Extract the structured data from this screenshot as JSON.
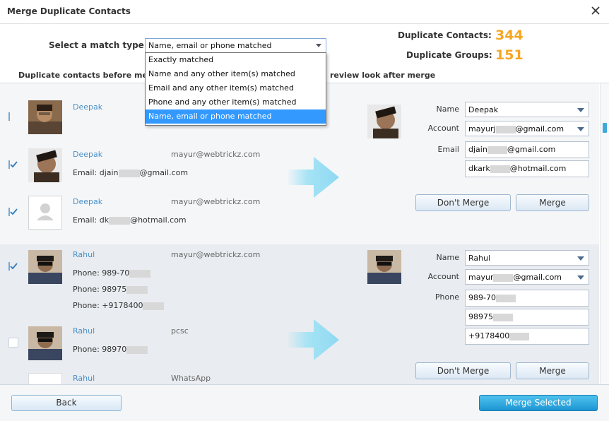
{
  "window": {
    "title": "Merge Duplicate Contacts"
  },
  "match": {
    "label": "Select a match type:",
    "selected": "Name, email or phone matched",
    "options": [
      "Exactly matched",
      "Name and any other item(s) matched",
      "Email and any other item(s) matched",
      "Phone and any other item(s) matched",
      "Name, email or phone matched"
    ]
  },
  "stats": {
    "contacts_label": "Duplicate Contacts:",
    "contacts_value": "344",
    "groups_label": "Duplicate Groups:",
    "groups_value": "151"
  },
  "columns": {
    "left": "Duplicate contacts before merg",
    "right": "review look after merge"
  },
  "groups": [
    {
      "contacts": [
        {
          "name": "Deepak",
          "source": "",
          "lines": []
        },
        {
          "name": "Deepak",
          "source": "mayur@webtrickz.com",
          "lines": [
            {
              "prefix": "Email: djain",
              "suffix": "@gmail.com"
            }
          ]
        },
        {
          "name": "Deepak",
          "source": "mayur@webtrickz.com",
          "lines": [
            {
              "prefix": "Email: dk",
              "suffix": "@hotmail.com"
            }
          ]
        }
      ],
      "preview": {
        "name_label": "Name",
        "name_value": "Deepak",
        "account_label": "Account",
        "account_prefix": "mayurj",
        "account_suffix": "@gmail.com",
        "email_label": "Email",
        "emails": [
          {
            "prefix": "djain",
            "suffix": "@gmail.com"
          },
          {
            "prefix": "dkark",
            "suffix": "@hotmail.com"
          }
        ]
      },
      "buttons": {
        "dont_merge": "Don't Merge",
        "merge": "Merge"
      }
    },
    {
      "contacts": [
        {
          "name": "Rahul",
          "source": "mayur@webtrickz.com",
          "lines": [
            {
              "prefix": "Phone: 989-70",
              "suffix": ""
            },
            {
              "prefix": "Phone: 98975",
              "suffix": ""
            },
            {
              "prefix": "Phone: +9178400",
              "suffix": ""
            }
          ]
        },
        {
          "name": "Rahul",
          "source": "pcsc",
          "lines": [
            {
              "prefix": "Phone: 98970",
              "suffix": ""
            }
          ]
        },
        {
          "name": "Rahul",
          "source": "WhatsApp",
          "lines": []
        }
      ],
      "preview": {
        "name_label": "Name",
        "name_value": "Rahul",
        "account_label": "Account",
        "account_prefix": "mayur",
        "account_suffix": "@gmail.com",
        "phone_label": "Phone",
        "phones": [
          "989-70",
          "98975",
          "+9178400"
        ]
      },
      "buttons": {
        "dont_merge": "Don't Merge",
        "merge": "Merge"
      }
    }
  ],
  "footer": {
    "back": "Back",
    "merge_selected": "Merge Selected"
  },
  "colors": {
    "accent": "#f5a623",
    "link": "#4a90c8",
    "selection": "#3399ff",
    "primary_button": "#1c95d2",
    "arrow": "#a6e3f5"
  }
}
